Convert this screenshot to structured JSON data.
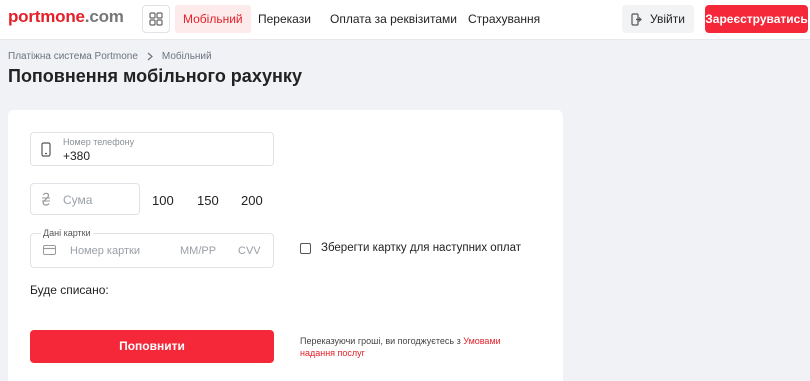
{
  "header": {
    "logo_main": "portmone",
    "logo_suffix": ".com",
    "nav": [
      "Мобільний",
      "Перекази",
      "Оплата за реквізитами",
      "Страхування"
    ],
    "login_label": "Увійти",
    "register_label": "Зареєструватись"
  },
  "breadcrumb": [
    "Платіжна система Portmone",
    "Мобільний"
  ],
  "page_title": "Поповнення мобільного рахунку",
  "form": {
    "phone_label": "Номер телефону",
    "phone_value": "+380",
    "sum_placeholder": "Сума",
    "amounts": [
      "100",
      "150",
      "200"
    ],
    "card_label": "Дані картки",
    "card_number_placeholder": "Номер картки",
    "expiry_placeholder": "MM/PP",
    "cvv_placeholder": "CVV",
    "save_card_label": "Зберегти картку для наступних оплат",
    "debit_label": "Буде списано:",
    "submit_label": "Поповнити",
    "terms_prefix": "Переказуючи гроші, ви погоджуєтесь з",
    "terms_link": "Умовами надання послуг"
  },
  "colors": {
    "accent": "#f5283a",
    "brand": "#e4212a"
  },
  "icons": [
    "apps-grid-icon",
    "login-icon",
    "phone-icon",
    "hryvnia-icon",
    "credit-card-icon",
    "chevron-right-icon"
  ]
}
